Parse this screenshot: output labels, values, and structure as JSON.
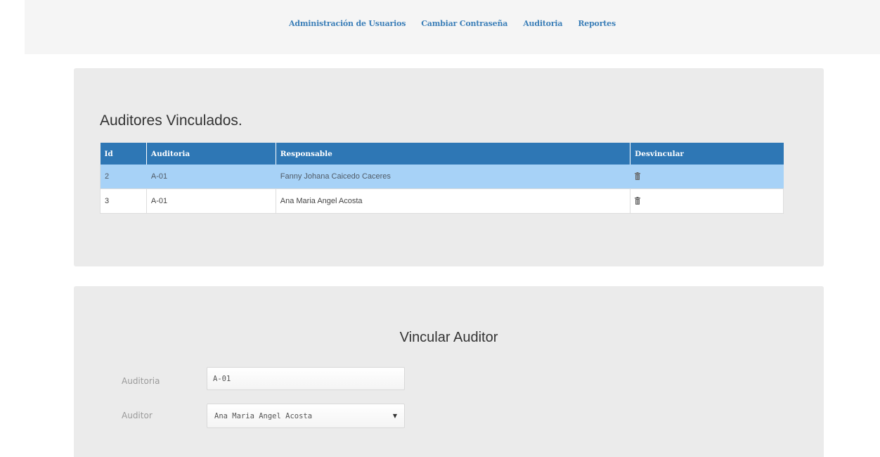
{
  "nav": {
    "items": [
      {
        "label": "Administración de Usuarios"
      },
      {
        "label": "Cambiar Contraseña"
      },
      {
        "label": "Auditoria"
      },
      {
        "label": "Reportes"
      }
    ]
  },
  "linked": {
    "title": "Auditores Vinculados.",
    "columns": [
      "Id",
      "Auditoria",
      "Responsable",
      "Desvincular"
    ],
    "rows": [
      {
        "id": "2",
        "auditoria": "A-01",
        "responsable": "Fanny Johana Caicedo Caceres",
        "action_icon": "trash-icon",
        "selected": true
      },
      {
        "id": "3",
        "auditoria": "A-01",
        "responsable": "Ana Maria Angel Acosta",
        "action_icon": "trash-icon",
        "selected": false
      }
    ]
  },
  "form": {
    "title": "Vincular Auditor",
    "auditoria_label": "Auditoria",
    "auditoria_value": "A-01",
    "auditor_label": "Auditor",
    "auditor_selected": "Ana Maria Angel Acosta",
    "caret_icon": "▼"
  },
  "colors": {
    "header_blue": "#2e77b5",
    "selected_row": "#a7d2f7",
    "nav_link": "#3c7fb8",
    "panel_bg": "#ebebeb"
  }
}
